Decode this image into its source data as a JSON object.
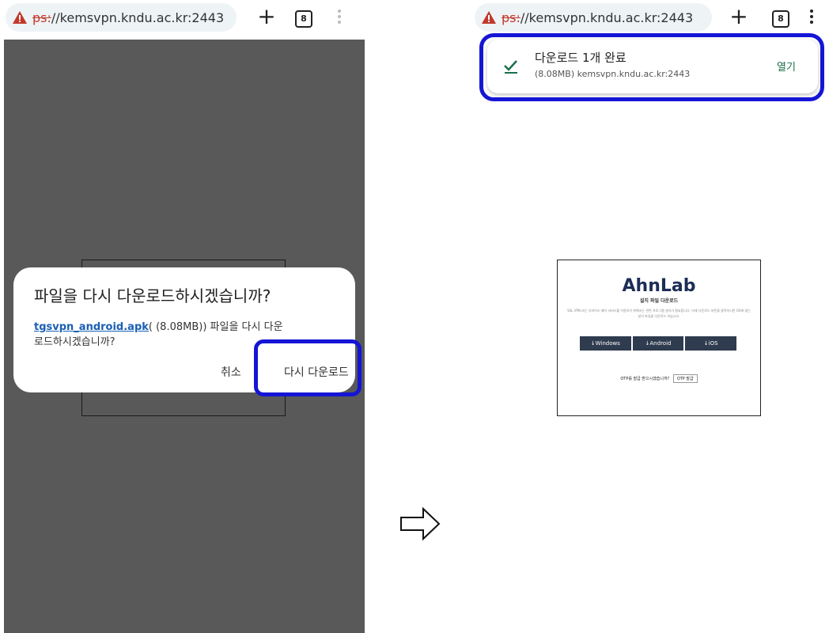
{
  "left": {
    "url_scheme": "ps:",
    "url_host": "//kemsvpn.kndu.ac.kr:2443",
    "tab_count": "8",
    "dialog": {
      "title": "파일을 다시 다운로드하시겠습니까?",
      "file_name": "tgsvpn_android.apk",
      "body_rest": "( (8.08MB)) 파일을 다시 다운로드하시겠습니까?",
      "cancel_label": "취소",
      "redownload_label": "다시 다운로드"
    }
  },
  "right": {
    "url_scheme": "ps:",
    "url_host": "//kemsvpn.kndu.ac.kr:2443",
    "tab_count": "8",
    "notification": {
      "title": "다운로드 1개 완료",
      "subtitle": "(8.08MB) kemsvpn.kndu.ac.kr:2443",
      "open_label": "열기"
    },
    "page": {
      "logo": "AhnLab",
      "subtitle": "설치 파일 다운로드",
      "description": "SSL VPN 또는 디바이스 제어 서비스를 이용하기 위해서는 관련 프로그램 설치가 필요합니다. 아래 다운로드 버튼을 클릭하시면 OS에 맞는 설치 파일을 다운로드 하십시오.",
      "buttons": [
        "↓Windows",
        "↓Android",
        "↓iOS"
      ],
      "otp_question": "OTP를 발급 받으시겠습니까?",
      "otp_button": "OTP 발급"
    }
  },
  "colors": {
    "highlight": "#1515d6",
    "dim_overlay": "#595959",
    "link": "#1a5fb4",
    "warning": "#c0392b",
    "button_dark": "#2f3b4e",
    "open_action": "#1a6f4a"
  }
}
